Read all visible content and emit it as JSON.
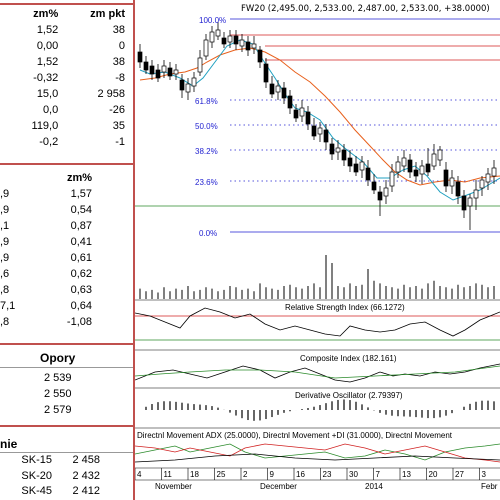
{
  "quotes_table": {
    "headers": [
      "zm%",
      "zm pkt"
    ],
    "rows": [
      [
        "1,52",
        "38"
      ],
      [
        "0,00",
        "0"
      ],
      [
        "1,52",
        "38"
      ],
      [
        "-0,32",
        "-8"
      ],
      [
        "15,0",
        "2 958"
      ],
      [
        "0,0",
        "-26"
      ],
      [
        "119,0",
        "35"
      ],
      [
        "-0,2",
        "-1"
      ]
    ]
  },
  "index_table": {
    "header": "zm%",
    "rows": [
      [
        ",9",
        "1,57"
      ],
      [
        ",9",
        "0,54"
      ],
      [
        ",1",
        "0,87"
      ],
      [
        ",9",
        "0,41"
      ],
      [
        ",9",
        "0,61"
      ],
      [
        ",6",
        "0,62"
      ],
      [
        ",8",
        "0,63"
      ],
      [
        "7,1",
        "0,64"
      ],
      [
        ",8",
        "-1,08"
      ]
    ]
  },
  "resistance": {
    "title": "Opory",
    "values": [
      "2 539",
      "2 550",
      "2 579"
    ]
  },
  "support": {
    "title": "nie",
    "rows": [
      [
        "SK-15",
        "2 458"
      ],
      [
        "SK-20",
        "2 432"
      ],
      [
        "SK-45",
        "2 412"
      ]
    ]
  },
  "chart": {
    "title": "FW20 (2,495.00, 2,533.00, 2,487.00, 2,533.00, +38.0000)",
    "fib_labels": [
      "100.0%",
      "61.8%",
      "50.0%",
      "38.2%",
      "23.6%",
      "0.0%"
    ],
    "fib_color": "#1f1fd0",
    "panels": [
      "Relative Strength Index (66.1272)",
      "Composite Index (182.161)",
      "Derivative Oscillator (2.79397)",
      "Directnl Movement ADX (25.0000), Directnl Movement +DI (31.0000), Directnl Movement"
    ],
    "x_ticks": [
      "4",
      "11",
      "18",
      "25",
      "2",
      "9",
      "16",
      "23",
      "30",
      "7",
      "13",
      "20",
      "27",
      "3"
    ],
    "months": [
      "November",
      "December",
      "2014",
      "Febr"
    ]
  },
  "chart_data": {
    "type": "candlestick",
    "title": "FW20 (2,495.00, 2,533.00, 2,487.00, 2,533.00, +38.0000)",
    "fib_levels": [
      {
        "label": "100.0%",
        "value": 100.0
      },
      {
        "label": "61.8%",
        "value": 61.8
      },
      {
        "label": "50.0%",
        "value": 50.0
      },
      {
        "label": "38.2%",
        "value": 38.2
      },
      {
        "label": "23.6%",
        "value": 23.6
      },
      {
        "label": "0.0%",
        "value": 0.0
      }
    ],
    "indicators": [
      {
        "name": "Relative Strength Index",
        "value": 66.1272
      },
      {
        "name": "Composite Index",
        "value": 182.161
      },
      {
        "name": "Derivative Oscillator",
        "value": 2.79397
      },
      {
        "name": "Directnl Movement ADX",
        "value": 25.0
      },
      {
        "name": "Directnl Movement +DI",
        "value": 31.0
      }
    ],
    "x_tick_labels": [
      "4",
      "11",
      "18",
      "25",
      "2",
      "9",
      "16",
      "23",
      "30",
      "7",
      "13",
      "20",
      "27",
      "3"
    ],
    "month_labels": [
      "November",
      "December",
      "2014",
      "Febr"
    ]
  }
}
